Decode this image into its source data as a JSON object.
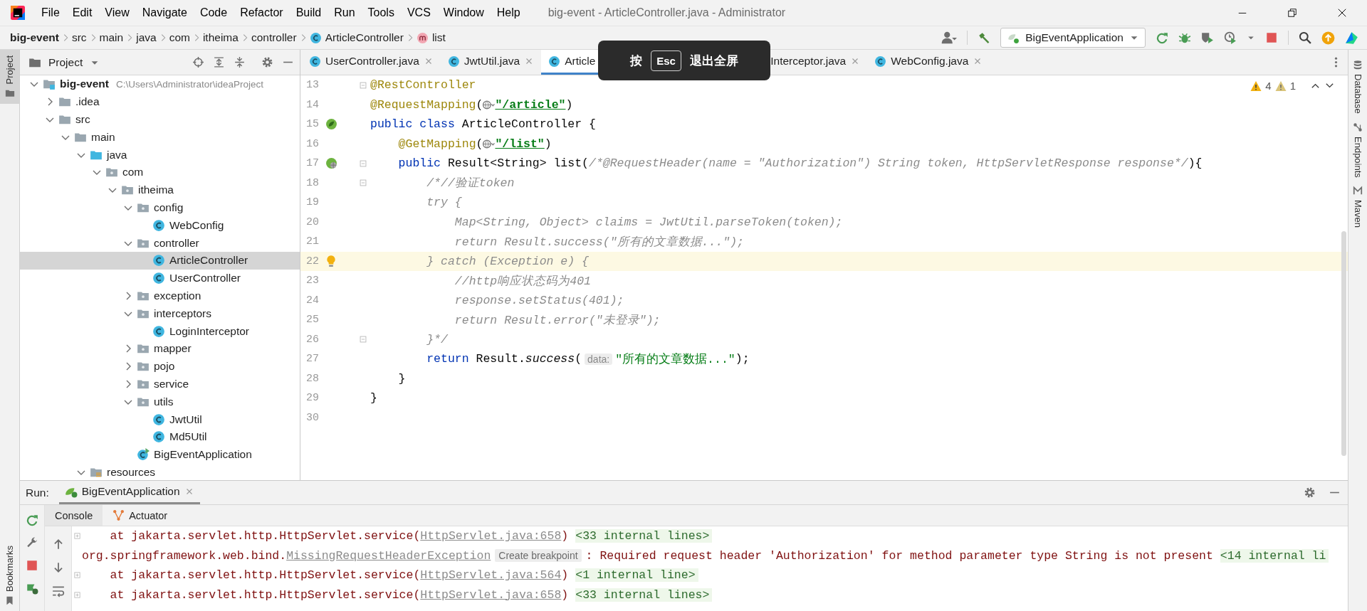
{
  "window": {
    "title": "big-event - ArticleController.java - Administrator"
  },
  "menu": [
    "File",
    "Edit",
    "View",
    "Navigate",
    "Code",
    "Refactor",
    "Build",
    "Run",
    "Tools",
    "VCS",
    "Window",
    "Help"
  ],
  "breadcrumb": [
    {
      "label": "big-event",
      "kind": "project"
    },
    {
      "label": "src",
      "kind": "dir"
    },
    {
      "label": "main",
      "kind": "dir"
    },
    {
      "label": "java",
      "kind": "dir"
    },
    {
      "label": "com",
      "kind": "dir"
    },
    {
      "label": "itheima",
      "kind": "dir"
    },
    {
      "label": "controller",
      "kind": "dir"
    },
    {
      "label": "ArticleController",
      "kind": "class"
    },
    {
      "label": "list",
      "kind": "method"
    }
  ],
  "run_config": {
    "label": "BigEventApplication"
  },
  "left_tools": [
    {
      "label": "Project",
      "selected": true
    }
  ],
  "bookmarks": {
    "label": "Bookmarks"
  },
  "right_tools": [
    {
      "label": "Database",
      "kind": "database"
    },
    {
      "label": "Endpoints",
      "kind": "endpoints"
    },
    {
      "label": "Maven",
      "kind": "maven"
    }
  ],
  "project_panel": {
    "title": "Project",
    "tree": [
      {
        "label": "big-event",
        "path": "C:\\Users\\Administrator\\ideaProject",
        "kind": "module",
        "expanded": true,
        "selected": false,
        "children": [
          {
            "label": ".idea",
            "kind": "folder",
            "expanded": false,
            "selected": false
          },
          {
            "label": "src",
            "kind": "folder",
            "expanded": true,
            "selected": false,
            "children": [
              {
                "label": "main",
                "kind": "folder",
                "expanded": true,
                "selected": false,
                "children": [
                  {
                    "label": "java",
                    "kind": "source",
                    "expanded": true,
                    "selected": false,
                    "children": [
                      {
                        "label": "com",
                        "kind": "package",
                        "expanded": true,
                        "selected": false,
                        "children": [
                          {
                            "label": "itheima",
                            "kind": "package",
                            "expanded": true,
                            "selected": false,
                            "children": [
                              {
                                "label": "config",
                                "kind": "package",
                                "expanded": true,
                                "selected": false,
                                "children": [
                                  {
                                    "label": "WebConfig",
                                    "kind": "class",
                                    "selected": false
                                  }
                                ]
                              },
                              {
                                "label": "controller",
                                "kind": "package",
                                "expanded": true,
                                "selected": false,
                                "children": [
                                  {
                                    "label": "ArticleController",
                                    "kind": "class",
                                    "selected": true
                                  },
                                  {
                                    "label": "UserController",
                                    "kind": "class",
                                    "selected": false
                                  }
                                ]
                              },
                              {
                                "label": "exception",
                                "kind": "package",
                                "expanded": false,
                                "selected": false
                              },
                              {
                                "label": "interceptors",
                                "kind": "package",
                                "expanded": true,
                                "selected": false,
                                "children": [
                                  {
                                    "label": "LoginInterceptor",
                                    "kind": "class",
                                    "selected": false
                                  }
                                ]
                              },
                              {
                                "label": "mapper",
                                "kind": "package",
                                "expanded": false,
                                "selected": false
                              },
                              {
                                "label": "pojo",
                                "kind": "package",
                                "expanded": false,
                                "selected": false
                              },
                              {
                                "label": "service",
                                "kind": "package",
                                "expanded": false,
                                "selected": false
                              },
                              {
                                "label": "utils",
                                "kind": "package",
                                "expanded": true,
                                "selected": false,
                                "children": [
                                  {
                                    "label": "JwtUtil",
                                    "kind": "class",
                                    "selected": false
                                  },
                                  {
                                    "label": "Md5Util",
                                    "kind": "class",
                                    "selected": false
                                  }
                                ]
                              },
                              {
                                "label": "BigEventApplication",
                                "kind": "app",
                                "selected": false
                              }
                            ]
                          }
                        ]
                      }
                    ]
                  },
                  {
                    "label": "resources",
                    "kind": "resources",
                    "expanded": true,
                    "selected": false
                  }
                ]
              }
            ]
          }
        ]
      }
    ]
  },
  "editor_tabs": [
    {
      "label": "UserController.java",
      "selected": false
    },
    {
      "label": "JwtUtil.java",
      "selected": false
    },
    {
      "label": "Article",
      "selected": true
    },
    {
      "label": "Interceptor.java",
      "selected": false
    },
    {
      "label": "WebConfig.java",
      "selected": false
    }
  ],
  "inspections": {
    "warnings": "4",
    "weak_warnings": "1"
  },
  "code_lines": [
    {
      "number": "13",
      "fold": true,
      "current": false,
      "segments": [
        {
          "kind": "annotation",
          "text": "@RestController"
        }
      ]
    },
    {
      "number": "14",
      "fold": false,
      "current": false,
      "segments": [
        {
          "kind": "annotation",
          "text": "@RequestMapping"
        },
        {
          "kind": "plain",
          "text": "("
        },
        {
          "kind": "url-icon"
        },
        {
          "kind": "url",
          "text": "\"/article\""
        },
        {
          "kind": "plain",
          "text": ")"
        }
      ]
    },
    {
      "number": "15",
      "fold": false,
      "current": false,
      "marker": {
        "kind": "bean"
      },
      "segments": [
        {
          "kind": "keyword",
          "text": "public class"
        },
        {
          "kind": "plain",
          "text": " ArticleController {"
        }
      ]
    },
    {
      "number": "16",
      "fold": false,
      "current": false,
      "segments": [
        {
          "kind": "annotation",
          "text": "    @GetMapping"
        },
        {
          "kind": "plain",
          "text": "("
        },
        {
          "kind": "url-icon"
        },
        {
          "kind": "url",
          "text": "\"/list\""
        },
        {
          "kind": "plain",
          "text": ")"
        }
      ]
    },
    {
      "number": "17",
      "fold": true,
      "current": false,
      "marker": {
        "kind": "bean-web"
      },
      "segments": [
        {
          "kind": "keyword",
          "text": "    public"
        },
        {
          "kind": "plain",
          "text": " Result<String> list("
        },
        {
          "kind": "comment",
          "text": "/*@RequestHeader(name = \"Authorization\") String token, HttpServletResponse response*/"
        },
        {
          "kind": "plain",
          "text": "){"
        }
      ]
    },
    {
      "number": "18",
      "fold": true,
      "current": false,
      "segments": [
        {
          "kind": "comment",
          "text": "        /*//验证token"
        }
      ]
    },
    {
      "number": "19",
      "fold": false,
      "current": false,
      "segments": [
        {
          "kind": "comment",
          "text": "        try {"
        }
      ]
    },
    {
      "number": "20",
      "fold": false,
      "current": false,
      "segments": [
        {
          "kind": "comment",
          "text": "            Map<String, Object> claims = JwtUtil.parseToken(token);"
        }
      ]
    },
    {
      "number": "21",
      "fold": false,
      "current": false,
      "segments": [
        {
          "kind": "comment",
          "text": "            return Result.success(\"所有的文章数据...\");"
        }
      ]
    },
    {
      "number": "22",
      "fold": false,
      "current": true,
      "marker": {
        "kind": "bulb"
      },
      "segments": [
        {
          "kind": "comment",
          "text": "        } catch (Exception e) {"
        }
      ]
    },
    {
      "number": "23",
      "fold": false,
      "current": false,
      "segments": [
        {
          "kind": "comment",
          "text": "            //http响应状态码为401"
        }
      ]
    },
    {
      "number": "24",
      "fold": false,
      "current": false,
      "segments": [
        {
          "kind": "comment",
          "text": "            response.setStatus(401);"
        }
      ]
    },
    {
      "number": "25",
      "fold": false,
      "current": false,
      "segments": [
        {
          "kind": "comment",
          "text": "            return Result.error(\"未登录\");"
        }
      ]
    },
    {
      "number": "26",
      "fold": true,
      "current": false,
      "segments": [
        {
          "kind": "comment",
          "text": "        }*/"
        }
      ]
    },
    {
      "number": "27",
      "fold": false,
      "current": false,
      "segments": [
        {
          "kind": "keyword",
          "text": "        return"
        },
        {
          "kind": "plain",
          "text": " Result."
        },
        {
          "kind": "call",
          "text": "success"
        },
        {
          "kind": "plain",
          "text": "("
        },
        {
          "kind": "hint",
          "text": "data:"
        },
        {
          "kind": "string",
          "text": "\"所有的文章数据...\""
        },
        {
          "kind": "plain",
          "text": ");"
        }
      ]
    },
    {
      "number": "28",
      "fold": false,
      "current": false,
      "segments": [
        {
          "kind": "plain",
          "text": "    }"
        }
      ]
    },
    {
      "number": "29",
      "fold": false,
      "current": false,
      "segments": [
        {
          "kind": "plain",
          "text": "}"
        }
      ]
    },
    {
      "number": "30",
      "fold": false,
      "current": false
    }
  ],
  "fullscreen_toast": {
    "before": "按",
    "key": "Esc",
    "after": "退出全屏"
  },
  "run_panel": {
    "label": "Run:",
    "tabs": [
      {
        "label": "BigEventApplication",
        "selected": true
      }
    ],
    "subtabs": [
      {
        "label": "Console",
        "kind": "console",
        "selected": true
      },
      {
        "label": "Actuator",
        "kind": "actuator",
        "selected": false
      }
    ],
    "console_lines": [
      {
        "fold": true,
        "segments": [
          {
            "kind": "text",
            "text": "    at jakarta.servlet.http.HttpServlet.service("
          },
          {
            "kind": "link",
            "text": "HttpServlet.java:658"
          },
          {
            "kind": "text",
            "text": ")"
          },
          {
            "kind": "folded",
            "text": "<33 internal lines>"
          }
        ]
      },
      {
        "fold": false,
        "segments": [
          {
            "kind": "text",
            "text": "org.springframework.web.bind."
          },
          {
            "kind": "link",
            "text": "MissingRequestHeaderException"
          },
          {
            "kind": "tag",
            "text": "Create breakpoint"
          },
          {
            "kind": "text",
            "text": ": Required request header 'Authorization' for method parameter type String is not present"
          },
          {
            "kind": "folded",
            "text": "<14 internal li"
          }
        ]
      },
      {
        "fold": true,
        "segments": [
          {
            "kind": "text",
            "text": "    at jakarta.servlet.http.HttpServlet.service("
          },
          {
            "kind": "link",
            "text": "HttpServlet.java:564"
          },
          {
            "kind": "text",
            "text": ")"
          },
          {
            "kind": "folded",
            "text": "<1 internal line>"
          }
        ]
      },
      {
        "fold": true,
        "segments": [
          {
            "kind": "text",
            "text": "    at jakarta.servlet.http.HttpServlet.service("
          },
          {
            "kind": "link",
            "text": "HttpServlet.java:658"
          },
          {
            "kind": "text",
            "text": ")"
          },
          {
            "kind": "folded",
            "text": "<33 internal lines>"
          }
        ]
      }
    ]
  }
}
